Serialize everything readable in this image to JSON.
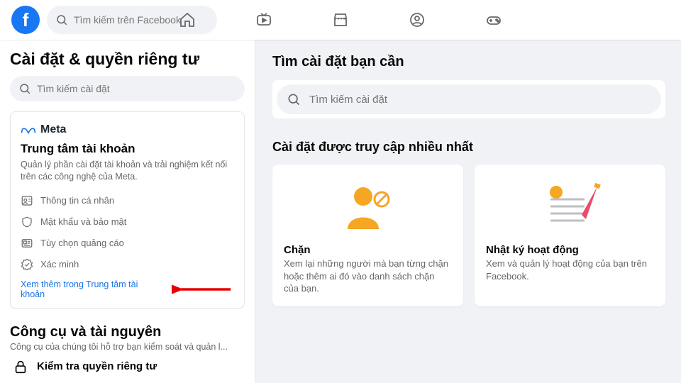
{
  "header": {
    "search_placeholder": "Tìm kiếm trên Facebook"
  },
  "sidebar": {
    "title": "Cài đặt & quyền riêng tư",
    "search_placeholder": "Tìm kiếm cài đặt",
    "meta_card": {
      "brand": "Meta",
      "title": "Trung tâm tài khoản",
      "subtitle": "Quản lý phần cài đặt tài khoản và trải nghiệm kết nối trên các công nghệ của Meta.",
      "rows": {
        "profile": "Thông tin cá nhân",
        "security": "Mật khẩu và bảo mật",
        "ads": "Tùy chọn quảng cáo",
        "verify": "Xác minh"
      },
      "link": "Xem thêm trong Trung tâm tài khoản"
    },
    "tools": {
      "title": "Công cụ và tài nguyên",
      "subtitle": "Công cụ của chúng tôi hỗ trợ bạn kiểm soát và quản l...",
      "privacy_checkup": "Kiểm tra quyền riêng tư"
    }
  },
  "main": {
    "title": "Tìm cài đặt bạn cần",
    "search_placeholder": "Tìm kiếm cài đặt",
    "most_visited_title": "Cài đặt được truy cập nhiều nhất",
    "tiles": {
      "block": {
        "title": "Chặn",
        "desc": "Xem lại những người mà bạn từng chặn hoặc thêm ai đó vào danh sách chặn của bạn."
      },
      "activity": {
        "title": "Nhật ký hoạt động",
        "desc": "Xem và quản lý hoạt động của bạn trên Facebook."
      }
    }
  }
}
